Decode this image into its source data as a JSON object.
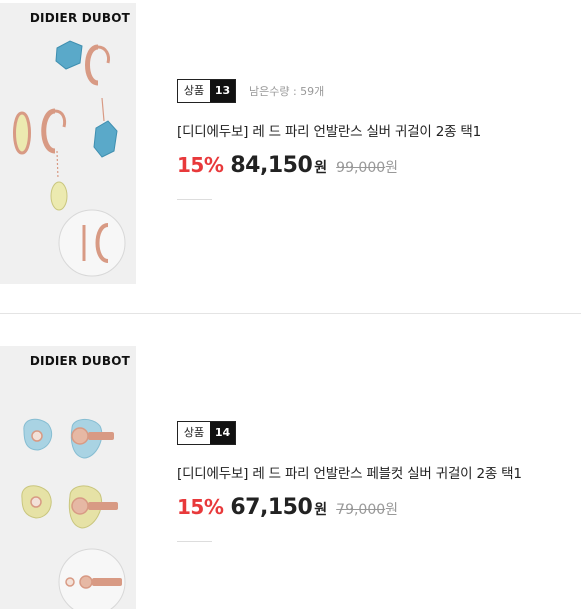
{
  "products": [
    {
      "brand_logo": "DIDIER DUBOT",
      "badge_label": "상품",
      "badge_number": "13",
      "stock": "남은수량 : 59개",
      "name": "[디디에두보] 레 드 파리 언발란스 실버 귀걸이 2종 택1",
      "discount_rate": "15%",
      "price": "84,150",
      "currency": "원",
      "original_price": "99,000",
      "original_currency": "원",
      "stone_colors": [
        "#5aa9c9",
        "#e8e6a8"
      ]
    },
    {
      "brand_logo": "DIDIER DUBOT",
      "badge_label": "상품",
      "badge_number": "14",
      "stock": "",
      "name": "[디디에두보] 레 드 파리 언발란스 페블컷 실버 귀걸이 2종 택1",
      "discount_rate": "15%",
      "price": "67,150",
      "currency": "원",
      "original_price": "79,000",
      "original_currency": "원",
      "stone_colors": [
        "#a9d3e3",
        "#e6e2a6"
      ]
    }
  ],
  "colors": {
    "discount": "#e8393b",
    "badge_dark": "#111111",
    "muted": "#999999"
  }
}
